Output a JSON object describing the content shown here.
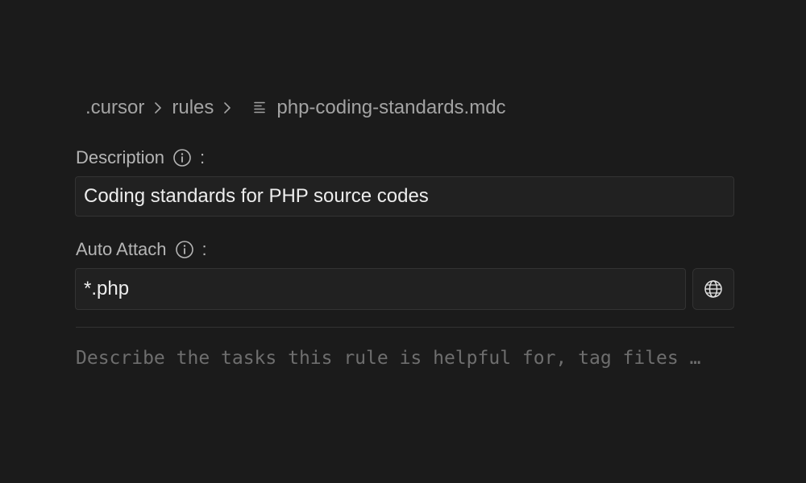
{
  "breadcrumb": {
    "items": [
      ".cursor",
      "rules"
    ],
    "file_name": "php-coding-standards.mdc",
    "file_icon": "file-lines-icon"
  },
  "description": {
    "label": "Description",
    "colon": ":",
    "info_icon": "info-icon",
    "value": "Coding standards for PHP source codes"
  },
  "auto_attach": {
    "label": "Auto Attach",
    "colon": ":",
    "info_icon": "info-icon",
    "value": "*.php",
    "globe_icon": "globe-icon"
  },
  "editor": {
    "placeholder": "Describe the tasks this rule is helpful for, tag files …"
  },
  "colors": {
    "background": "#1b1b1b",
    "input_background": "#212121",
    "border": "#333333"
  }
}
